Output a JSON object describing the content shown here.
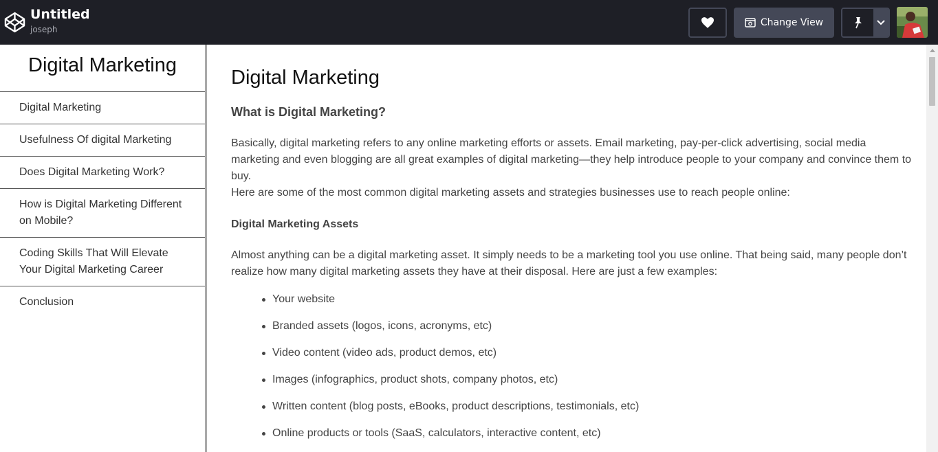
{
  "header": {
    "pen_title": "Untitled",
    "user": "joseph",
    "change_view_label": "Change View",
    "icons": [
      "codepen-logo-icon",
      "heart-icon",
      "change-view-icon",
      "pin-icon",
      "chevron-down-icon"
    ]
  },
  "sidebar": {
    "title": "Digital Marketing",
    "items": [
      {
        "label": "Digital Marketing"
      },
      {
        "label": "Usefulness Of digital Marketing"
      },
      {
        "label": "Does Digital Marketing Work?"
      },
      {
        "label": "How is Digital Marketing Different on Mobile?"
      },
      {
        "label": "Coding Skills That Will Elevate Your Digital Marketing Career"
      },
      {
        "label": "Conclusion"
      }
    ]
  },
  "main": {
    "title": "Digital Marketing",
    "subtitle": "What is Digital Marketing?",
    "para1": "Basically, digital marketing refers to any online marketing efforts or assets. Email marketing, pay-per-click advertising, social media marketing and even blogging are all great examples of digital marketing—they help introduce people to your company and convince them to buy.",
    "para2": "Here are some of the most common digital marketing assets and strategies businesses use to reach people online:",
    "assets_heading": "Digital Marketing Assets",
    "para3": "Almost anything can be a digital marketing asset. It simply needs to be a marketing tool you use online. That being said, many people don’t realize how many digital marketing assets they have at their disposal. Here are just a few examples:",
    "assets": [
      "Your website",
      "Branded assets (logos, icons, acronyms, etc)",
      "Video content (video ads, product demos, etc)",
      "Images (infographics, product shots, company photos, etc)",
      "Written content (blog posts, eBooks, product descriptions, testimonials, etc)",
      "Online products or tools (SaaS, calculators, interactive content, etc)"
    ]
  },
  "colors": {
    "topbar_bg": "#1e1f26",
    "button_bg": "#444857",
    "text": "#444444"
  }
}
